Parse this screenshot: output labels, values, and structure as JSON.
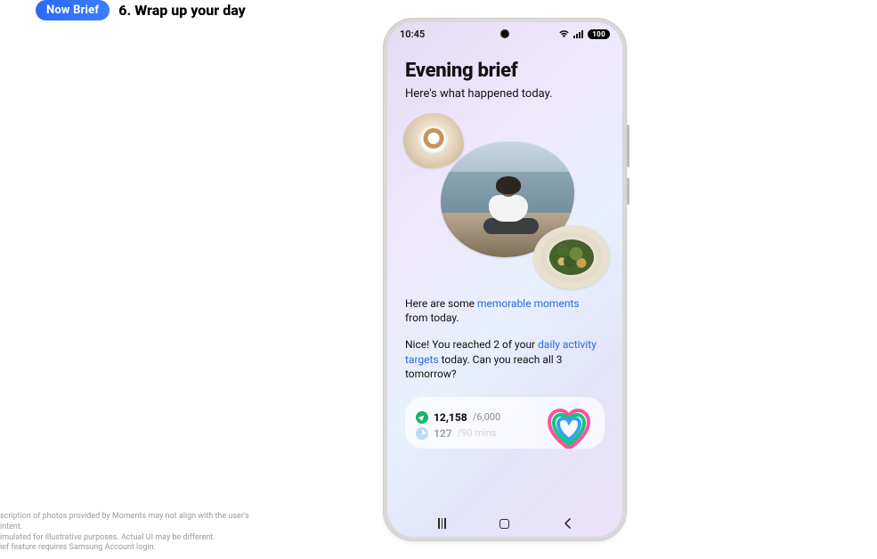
{
  "header": {
    "pill": "Now Brief",
    "title": "6. Wrap up your day"
  },
  "status": {
    "time": "10:45",
    "battery": "100"
  },
  "brief": {
    "title": "Evening brief",
    "subtitle": "Here's what happened today."
  },
  "moments": {
    "prefix": "Here are some ",
    "link": "memorable moments",
    "suffix": " from today."
  },
  "activity_msg": {
    "prefix": "Nice! You reached 2 of your ",
    "link": "daily activity targets",
    "suffix": " today. Can you reach all 3 tomorrow?"
  },
  "activity": {
    "steps": {
      "value": "12,158",
      "goal": "/6,000"
    },
    "active_time": {
      "value": "127",
      "goal": "/90 mins"
    }
  },
  "disclaimers": {
    "l1": "scription of photos provided by Moments may not align with the user's intent.",
    "l2": "imulated for illustrative purposes. Actual UI may be different.",
    "l3": "ief feature requires Samsung Account login."
  },
  "colors": {
    "accent_blue": "#2a6ae0",
    "pill_blue": "#2a6af5",
    "step_green": "#19b36b",
    "time_blue": "#3aa0e6",
    "ring_pink": "#ff4fa3",
    "ring_green": "#19c27a",
    "ring_blue": "#33a3ef"
  }
}
